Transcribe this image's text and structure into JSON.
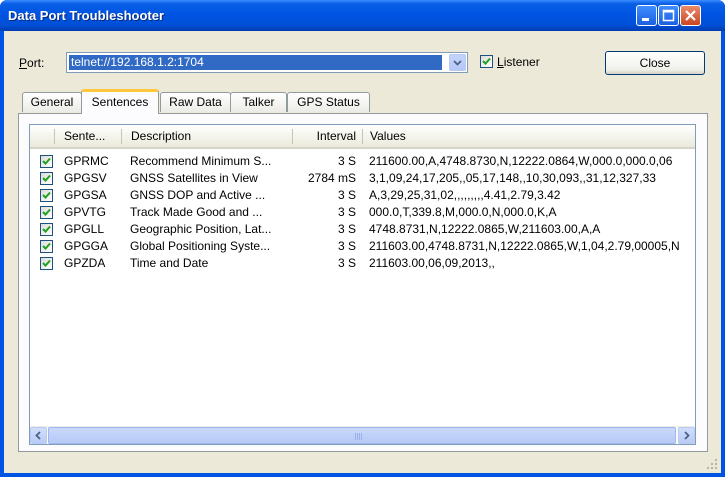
{
  "window": {
    "title": "Data Port Troubleshooter"
  },
  "port": {
    "label": "Port:",
    "value": "telnet://192.168.1.2:1704",
    "listener_label": "Listener",
    "listener_checked": true,
    "close_label": "Close"
  },
  "tabs": [
    "General",
    "Sentences",
    "Raw Data",
    "Talker",
    "GPS Status"
  ],
  "active_tab": "Sentences",
  "columns": [
    "Sente...",
    "Description",
    "Interval",
    "Values"
  ],
  "rows": [
    {
      "checked": true,
      "sentence": "GPRMC",
      "description": "Recommend Minimum S...",
      "interval": "3 S",
      "values": "211600.00,A,4748.8730,N,12222.0864,W,000.0,000.0,06"
    },
    {
      "checked": true,
      "sentence": "GPGSV",
      "description": "GNSS Satellites in View",
      "interval": "2784 mS",
      "values": "3,1,09,24,17,205,,05,17,148,,10,30,093,,31,12,327,33"
    },
    {
      "checked": true,
      "sentence": "GPGSA",
      "description": "GNSS DOP and Active ...",
      "interval": "3 S",
      "values": "A,3,29,25,31,02,,,,,,,,,4.41,2.79,3.42"
    },
    {
      "checked": true,
      "sentence": "GPVTG",
      "description": "Track Made Good and ...",
      "interval": "3 S",
      "values": "000.0,T,339.8,M,000.0,N,000.0,K,A"
    },
    {
      "checked": true,
      "sentence": "GPGLL",
      "description": "Geographic Position, Lat...",
      "interval": "3 S",
      "values": "4748.8731,N,12222.0865,W,211603.00,A,A"
    },
    {
      "checked": true,
      "sentence": "GPGGA",
      "description": "Global Positioning Syste...",
      "interval": "3 S",
      "values": "211603.00,4748.8731,N,12222.0865,W,1,04,2.79,00005,N"
    },
    {
      "checked": true,
      "sentence": "GPZDA",
      "description": "Time and Date",
      "interval": "3 S",
      "values": "211603.00,06,09,2013,,"
    }
  ],
  "icons": {
    "minimize": "minimize-icon",
    "maximize": "maximize-icon",
    "close": "close-icon",
    "dropdown": "chevron-down-icon",
    "scroll_left": "arrow-left-icon",
    "scroll_right": "arrow-right-icon",
    "resize_grip": "resize-grip-icon"
  }
}
